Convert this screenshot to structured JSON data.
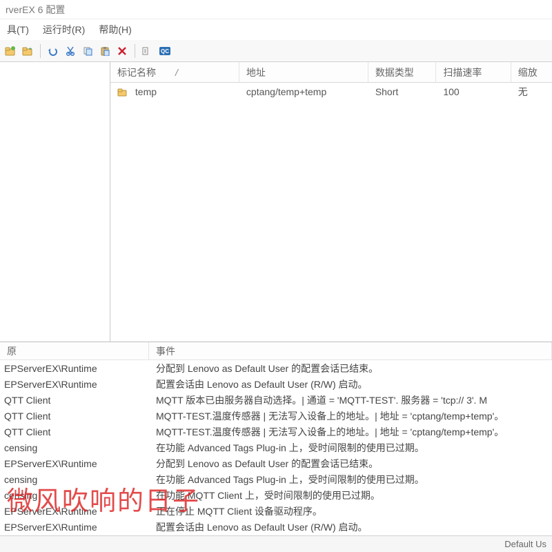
{
  "title": "rverEX 6 配置",
  "menu": {
    "tools": "具(T)",
    "runtime": "运行时(R)",
    "help": "帮助(H)"
  },
  "columns": {
    "tag_name": "标记名称",
    "sort_mark": "/",
    "address": "地址",
    "data_type": "数据类型",
    "scan_rate": "扫描速率",
    "scaling": "缩放"
  },
  "rows": [
    {
      "tag_name": "temp",
      "address": "cptang/temp+temp",
      "data_type": "Short",
      "scan_rate": "100",
      "scaling": "无"
    }
  ],
  "log_columns": {
    "source": "原",
    "event": "事件"
  },
  "log": [
    {
      "source": "EPServerEX\\Runtime",
      "event": "分配到 Lenovo as Default User 的配置会话已结束。"
    },
    {
      "source": "EPServerEX\\Runtime",
      "event": "配置会话由 Lenovo as Default User (R/W) 启动。"
    },
    {
      "source": "QTT Client",
      "event": "MQTT 版本已由服务器自动选择。| 通道 = 'MQTT-TEST'. 服务器 = 'tcp://                       3'. M"
    },
    {
      "source": "QTT Client",
      "event": "MQTT-TEST.温度传感器 | 无法写入设备上的地址。| 地址 = 'cptang/temp+temp'。"
    },
    {
      "source": "QTT Client",
      "event": "MQTT-TEST.温度传感器 | 无法写入设备上的地址。| 地址 = 'cptang/temp+temp'。"
    },
    {
      "source": "censing",
      "event": "在功能 Advanced Tags Plug-in 上，受时间限制的使用已过期。"
    },
    {
      "source": "EPServerEX\\Runtime",
      "event": "分配到 Lenovo as Default User 的配置会话已结束。"
    },
    {
      "source": "censing",
      "event": "在功能 Advanced Tags Plug-in 上，受时间限制的使用已过期。"
    },
    {
      "source": "censing",
      "event": "在功能 MQTT Client 上，受时间限制的使用已过期。"
    },
    {
      "source": "EPServerEX\\Runtime",
      "event": "正在停止 MQTT Client 设备驱动程序。"
    },
    {
      "source": "EPServerEX\\Runtime",
      "event": "配置会话由 Lenovo as Default User (R/W) 启动。"
    }
  ],
  "statusbar": {
    "user": "Default Us"
  },
  "watermark": "微风吹响的日子"
}
